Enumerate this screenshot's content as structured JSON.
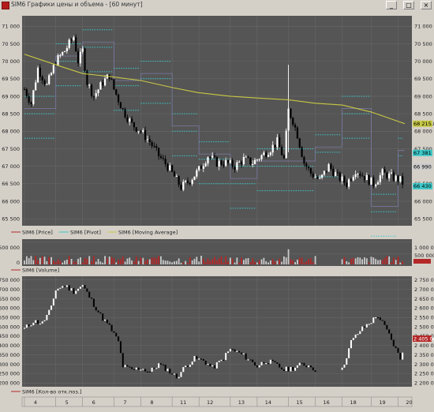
{
  "window": {
    "title": "SIM6 Графики цены и объема - [60 минут]",
    "btn_min": "_",
    "btn_max": "□",
    "btn_close": "×"
  },
  "colors": {
    "panel_bg": "#555555",
    "grid": "#6a6a6a",
    "candle_up": "#ffffff",
    "candle_down": "#000000",
    "pivot": "#3cc8c8",
    "ma": "#c8c846",
    "vol_up": "#b42828",
    "vol_down": "#cccccc",
    "oi_line": "#000000"
  },
  "price_panel": {
    "y_ticks": [
      "71 000",
      "70 500",
      "70 000",
      "69 500",
      "69 000",
      "68 500",
      "68 000",
      "67 500",
      "67 000",
      "66 500",
      "66 000",
      "65 500"
    ],
    "y_ticks_right": [
      "71 000",
      "70 500",
      "70 000",
      "69 500",
      "69 000",
      "68 500",
      "68 000",
      "67 500",
      "67 000",
      "66 500",
      "66 000",
      "65 500"
    ],
    "markers": [
      {
        "text": "68 215.8",
        "value": 68215.8,
        "bg": "#c8c846",
        "fg": "#000000"
      },
      {
        "text": "67 381",
        "value": 67381,
        "bg": "#3cc8c8",
        "fg": "#000000"
      },
      {
        "text": "66 990",
        "value": 66990,
        "bg": "#cccccc",
        "fg": "#000000"
      },
      {
        "text": "66 430",
        "value": 66430,
        "bg": "#3cc8c8",
        "fg": "#000000"
      }
    ],
    "legend": [
      {
        "label": "SIM6 [Price]",
        "color": "#b42828"
      },
      {
        "label": "SIM6 [Pivot]",
        "color": "#3cc8c8"
      },
      {
        "label": "SIM6 [Moving Average]",
        "color": "#c8c846"
      }
    ]
  },
  "volume_panel": {
    "y_ticks_left": [
      "500 000",
      "0"
    ],
    "y_ticks_right": [
      "1 000 000",
      "500 000"
    ],
    "legend": [
      {
        "label": "SIM6 [Volume]",
        "color": "#b42828"
      }
    ]
  },
  "oi_panel": {
    "y_ticks_left": [
      "750 000",
      "700 000",
      "650 000",
      "600 000",
      "550 000",
      "500 000",
      "450 000",
      "400 000",
      "350 000",
      "300 000",
      "250 000",
      "200 000"
    ],
    "y_ticks_right": [
      "2 750 000",
      "2 700 000",
      "2 650 000",
      "2 600 000",
      "2 550 000",
      "2 500 000",
      "2 450 000",
      "2 400 000",
      "2 350 000",
      "2 300 000",
      "2 250 000",
      "2 200 000"
    ],
    "marker": {
      "text": "2 405 000",
      "bg": "#b42828",
      "fg": "#ffffff"
    },
    "legend": [
      {
        "label": "SIM6 [Кол-во отк.поз.]",
        "color": "#b42828"
      }
    ]
  },
  "x_axis": {
    "day_labels": [
      "4",
      "5",
      "6",
      "7",
      "8",
      "11",
      "12",
      "13",
      "14",
      "15",
      "16",
      "18",
      "19",
      "20"
    ]
  },
  "chart_data": [
    {
      "type": "line",
      "title": "SIM6 [Price]",
      "x": [
        "4",
        "5",
        "6",
        "7",
        "8",
        "11",
        "12",
        "13",
        "14",
        "15",
        "16",
        "18",
        "19",
        "20"
      ],
      "ylim": [
        65300,
        71300
      ],
      "series": [
        {
          "name": "SIM6 [Price]",
          "values": [
            69100,
            70400,
            70500,
            69000,
            69200,
            68200,
            67900,
            66600,
            67000,
            67000,
            67200,
            68800,
            66600,
            66600
          ]
        },
        {
          "name": "SIM6 [Pivot]",
          "values": [
            68500,
            70000,
            70400,
            69300,
            69500,
            68000,
            67200,
            66500,
            67000,
            67000,
            67400,
            68500,
            65700,
            67300
          ]
        },
        {
          "name": "SIM6 [Moving Average]",
          "values": [
            70200,
            69900,
            69650,
            69550,
            69450,
            69250,
            69100,
            69000,
            68950,
            68900,
            68800,
            68750,
            68550,
            68215.8
          ]
        }
      ]
    },
    {
      "type": "bar",
      "title": "SIM6 [Volume]",
      "ylim": [
        0,
        1000000
      ]
    },
    {
      "type": "line",
      "title": "SIM6 [Кол-во отк.поз.]",
      "x": [
        "4",
        "5",
        "6",
        "7",
        "8",
        "11",
        "12",
        "13",
        "14",
        "15",
        "16",
        "18",
        "19",
        "20"
      ],
      "ylim": [
        180000,
        770000
      ],
      "series": [
        {
          "name": "SIM6 [Кол-во отк.поз.]",
          "values": [
            520000,
            720000,
            520000,
            280000,
            260000,
            310000,
            330000,
            380000,
            310000,
            280000,
            280000,
            540000,
            390000,
            420000
          ]
        }
      ]
    }
  ]
}
